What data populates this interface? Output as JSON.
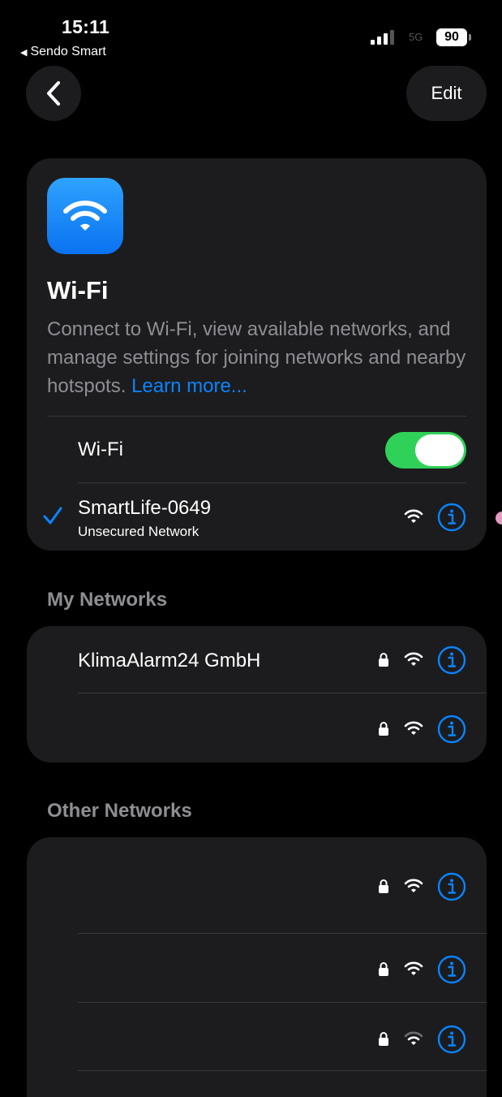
{
  "status_bar": {
    "time": "15:11",
    "back_app": "Sendo Smart",
    "network": "5G",
    "battery": "90"
  },
  "nav": {
    "edit_label": "Edit"
  },
  "header": {
    "title": "Wi-Fi",
    "description": "Connect to Wi-Fi, view available networks, and manage settings for joining networks and nearby hotspots. ",
    "learn_more": "Learn more..."
  },
  "wifi_toggle": {
    "label": "Wi-Fi",
    "on": true
  },
  "connected": {
    "name": "SmartLife-0649",
    "subtitle": "Unsecured Network"
  },
  "my_networks": {
    "heading": "My Networks",
    "items": [
      {
        "name": "KlimaAlarm24 GmbH",
        "locked": true
      },
      {
        "name": "",
        "locked": true
      }
    ]
  },
  "other_networks": {
    "heading": "Other Networks",
    "items": [
      {
        "name": "",
        "locked": true
      },
      {
        "name": "",
        "locked": true
      },
      {
        "name": "",
        "locked": true
      }
    ]
  },
  "colors": {
    "accent": "#0a84ff",
    "toggle_on": "#30d158",
    "card": "#1c1c1e",
    "secondary_text": "#8e8e93"
  }
}
